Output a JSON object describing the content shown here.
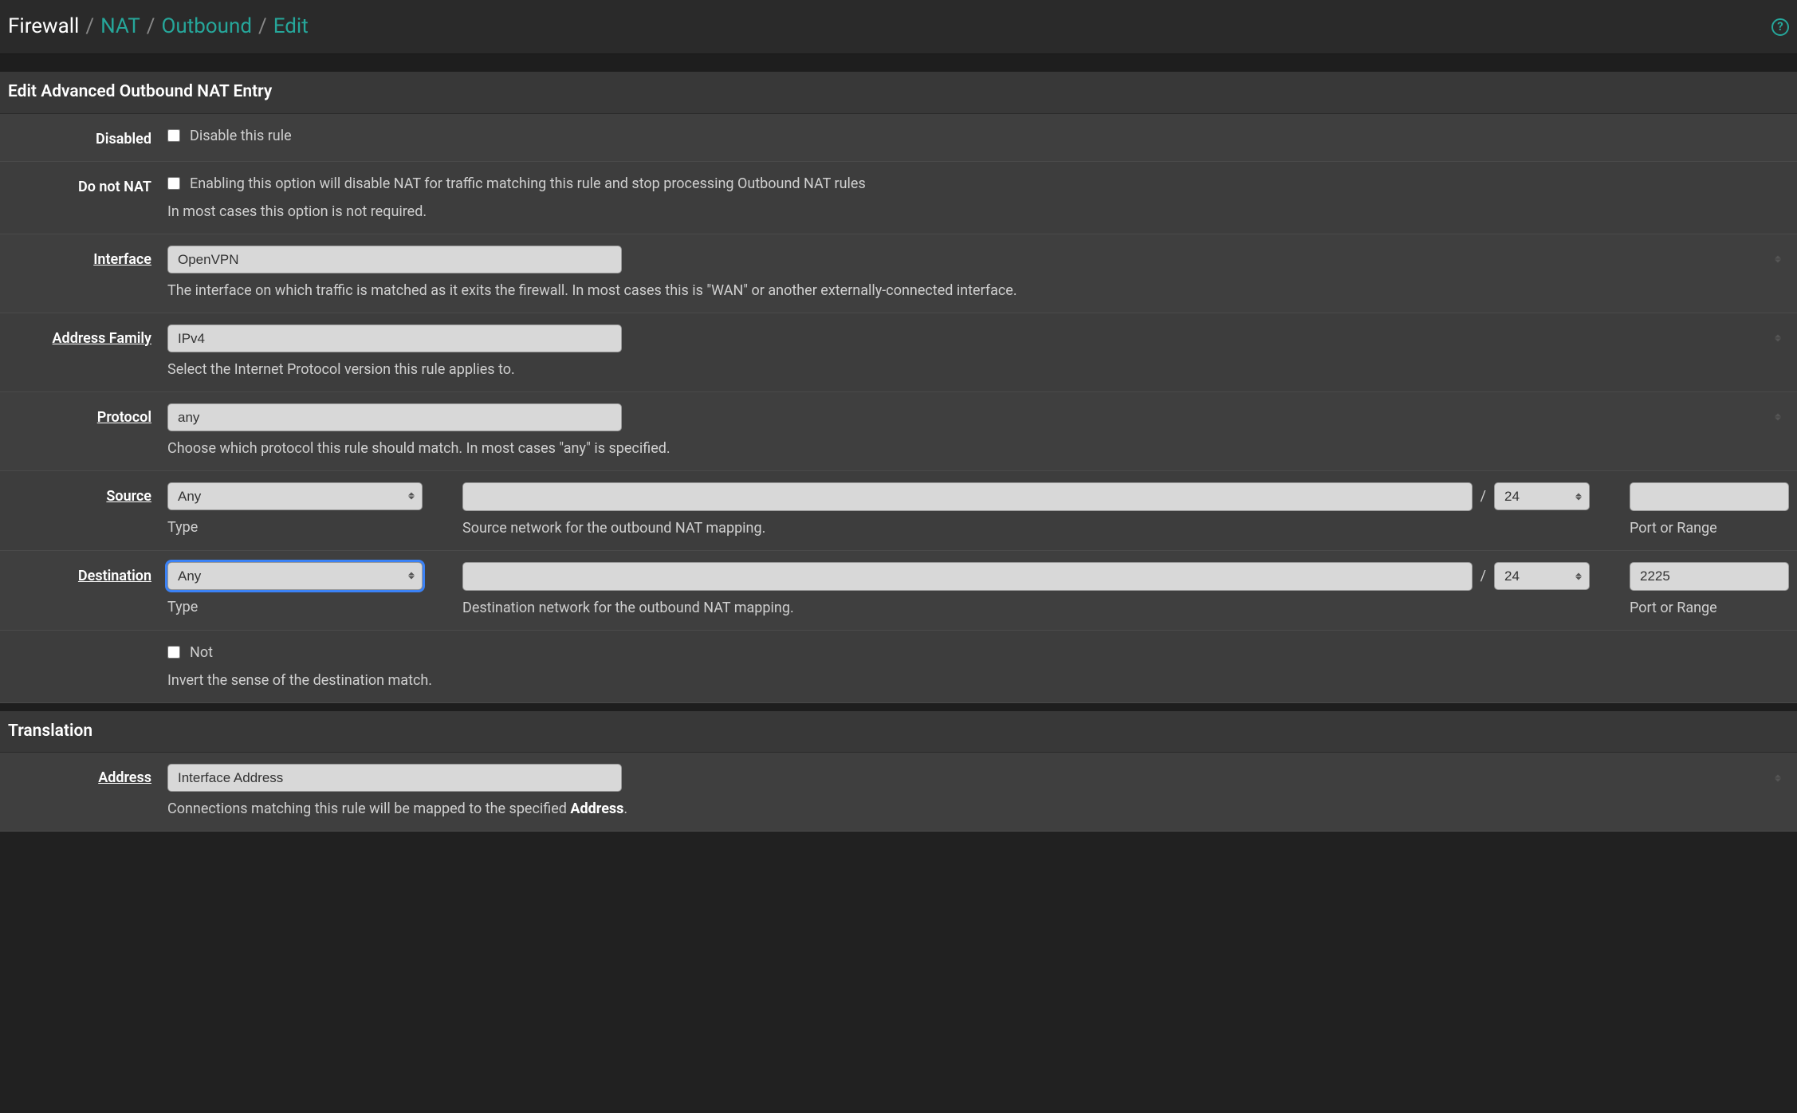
{
  "breadcrumb": {
    "root": "Firewall",
    "nat": "NAT",
    "outbound": "Outbound",
    "edit": "Edit"
  },
  "panel1": {
    "title": "Edit Advanced Outbound NAT Entry",
    "disabled": {
      "label": "Disabled",
      "checkbox_label": "Disable this rule"
    },
    "donotnat": {
      "label": "Do not NAT",
      "checkbox_label": "Enabling this option will disable NAT for traffic matching this rule and stop processing Outbound NAT rules",
      "help": "In most cases this option is not required."
    },
    "interface": {
      "label": "Interface",
      "value": "OpenVPN",
      "help": "The interface on which traffic is matched as it exits the firewall. In most cases this is \"WAN\" or another externally-connected interface."
    },
    "address_family": {
      "label": "Address Family",
      "value": "IPv4",
      "help": "Select the Internet Protocol version this rule applies to."
    },
    "protocol": {
      "label": "Protocol",
      "value": "any",
      "help": "Choose which protocol this rule should match. In most cases \"any\" is specified."
    },
    "source": {
      "label": "Source",
      "type_value": "Any",
      "type_label": "Type",
      "network_value": "",
      "mask_value": "24",
      "network_label": "Source network for the outbound NAT mapping.",
      "port_value": "",
      "port_label": "Port or Range"
    },
    "destination": {
      "label": "Destination",
      "type_value": "Any",
      "type_label": "Type",
      "network_value": "",
      "mask_value": "24",
      "network_label": "Destination network for the outbound NAT mapping.",
      "port_value": "2225",
      "port_label": "Port or Range"
    },
    "not": {
      "checkbox_label": "Not",
      "help": "Invert the sense of the destination match."
    }
  },
  "panel2": {
    "title": "Translation",
    "address": {
      "label": "Address",
      "value": "Interface Address",
      "help_pre": "Connections matching this rule will be mapped to the specified ",
      "help_bold": "Address",
      "help_post": "."
    }
  }
}
